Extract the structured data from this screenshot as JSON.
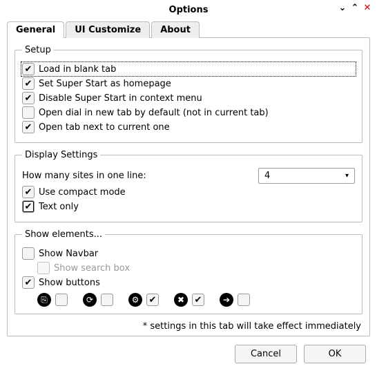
{
  "window": {
    "title": "Options"
  },
  "tabs": {
    "general": "General",
    "ui_customize": "UI Customize",
    "about": "About"
  },
  "setup": {
    "legend": "Setup",
    "items": [
      {
        "label": "Load in blank tab",
        "checked": true,
        "focused": true
      },
      {
        "label": "Set Super Start as homepage",
        "checked": true
      },
      {
        "label": "Disable Super Start in context menu",
        "checked": true
      },
      {
        "label": "Open dial in new tab by default (not in current tab)",
        "checked": false
      },
      {
        "label": "Open tab next to current one",
        "checked": true
      }
    ]
  },
  "display": {
    "legend": "Display Settings",
    "sites_per_line_label": "How many sites in one line:",
    "sites_per_line_value": "4",
    "compact": {
      "label": "Use compact mode",
      "checked": true
    },
    "text_only": {
      "label": "Text only",
      "checked": true,
      "boxed": true
    }
  },
  "show_elements": {
    "legend": "Show elements...",
    "navbar": {
      "label": "Show Navbar",
      "checked": false
    },
    "searchbox": {
      "label": "Show search box",
      "checked": false,
      "disabled": true
    },
    "buttons": {
      "label": "Show buttons",
      "checked": true
    },
    "button_icons": [
      {
        "name": "newtab-icon",
        "glyph": "⎘",
        "checked": false
      },
      {
        "name": "refresh-icon",
        "glyph": "⟳",
        "checked": false
      },
      {
        "name": "config-icon",
        "glyph": "⚙",
        "checked": true
      },
      {
        "name": "remove-icon",
        "glyph": "✖",
        "checked": true
      },
      {
        "name": "next-icon",
        "glyph": "➔",
        "checked": false
      }
    ]
  },
  "footnote": "* settings in this tab will take effect immediately",
  "buttons": {
    "cancel": "Cancel",
    "ok": "OK"
  }
}
